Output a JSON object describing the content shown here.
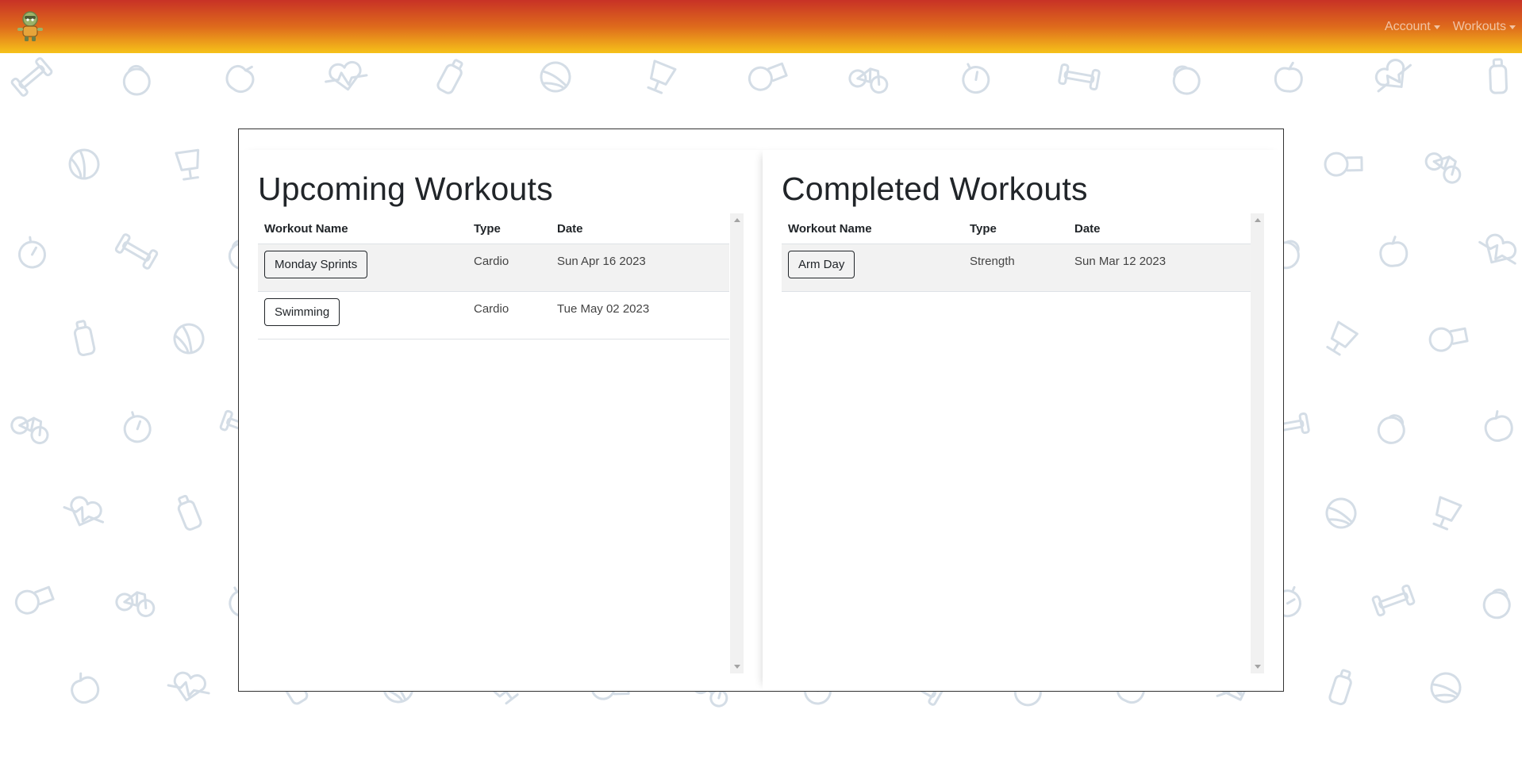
{
  "nav": {
    "brand_icon": "mascot-logo-icon",
    "items": [
      {
        "label": "Account"
      },
      {
        "label": "Workouts"
      }
    ]
  },
  "upcoming": {
    "title": "Upcoming Workouts",
    "columns": [
      "Workout Name",
      "Type",
      "Date"
    ],
    "rows": [
      {
        "name": "Monday Sprints",
        "type": "Cardio",
        "date": "Sun Apr 16 2023"
      },
      {
        "name": "Swimming",
        "type": "Cardio",
        "date": "Tue May 02 2023"
      }
    ]
  },
  "completed": {
    "title": "Completed Workouts",
    "columns": [
      "Workout Name",
      "Type",
      "Date"
    ],
    "rows": [
      {
        "name": "Arm Day",
        "type": "Strength",
        "date": "Sun Mar 12 2023"
      }
    ]
  },
  "colors": {
    "header_gradient_top": "#c83226",
    "header_gradient_bottom": "#f6c21a",
    "pattern_stroke": "#d4dde6"
  }
}
